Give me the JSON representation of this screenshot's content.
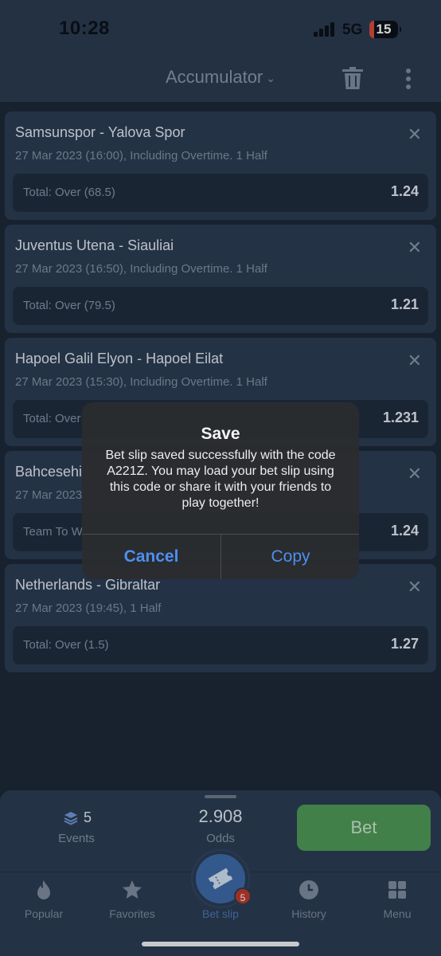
{
  "status": {
    "time": "10:28",
    "network": "5G",
    "battery": "15"
  },
  "header": {
    "title": "Accumulator",
    "title_icon": "chevron-down-icon"
  },
  "bets": [
    {
      "match": "Samsunspor - Yalova Spor",
      "meta": "27 Mar 2023 (16:00), Including Overtime. 1 Half",
      "outcome": "Total: Over (68.5)",
      "odd": "1.24"
    },
    {
      "match": "Juventus Utena - Siauliai",
      "meta": "27 Mar 2023 (16:50), Including Overtime. 1 Half",
      "outcome": "Total: Over (79.5)",
      "odd": "1.21"
    },
    {
      "match": "Hapoel Galil Elyon - Hapoel Eilat",
      "meta": "27 Mar 2023 (15:30), Including Overtime. 1 Half",
      "outcome": "Total: Over",
      "odd": "1.231"
    },
    {
      "match": "Bahcesehi",
      "meta": "27 Mar 2023",
      "outcome": "Team To W",
      "odd": "1.24"
    },
    {
      "match": "Netherlands - Gibraltar",
      "meta": "27 Mar 2023 (19:45), 1 Half",
      "outcome": "Total: Over (1.5)",
      "odd": "1.27"
    }
  ],
  "summary": {
    "events_count": "5",
    "events_label": "Events",
    "odds_value": "2.908",
    "odds_label": "Odds",
    "bet_label": "Bet"
  },
  "tabs": [
    {
      "label": "Popular",
      "icon": "flame-icon"
    },
    {
      "label": "Favorites",
      "icon": "star-icon"
    },
    {
      "label": "Bet slip",
      "icon": "ticket-icon"
    },
    {
      "label": "History",
      "icon": "clock-icon"
    },
    {
      "label": "Menu",
      "icon": "grid-icon"
    }
  ],
  "betslip_badge": "5",
  "alert": {
    "title": "Save",
    "message": "Bet slip saved successfully with the code A221Z. You may load your bet slip using this code or share it with your friends to play together!",
    "cancel_label": "Cancel",
    "copy_label": "Copy"
  },
  "colors": {
    "accent_blue": "#4d8ff0",
    "bet_green": "#4f9a55",
    "badge_red": "#c0392b",
    "battery_low": "#d94a3a"
  }
}
